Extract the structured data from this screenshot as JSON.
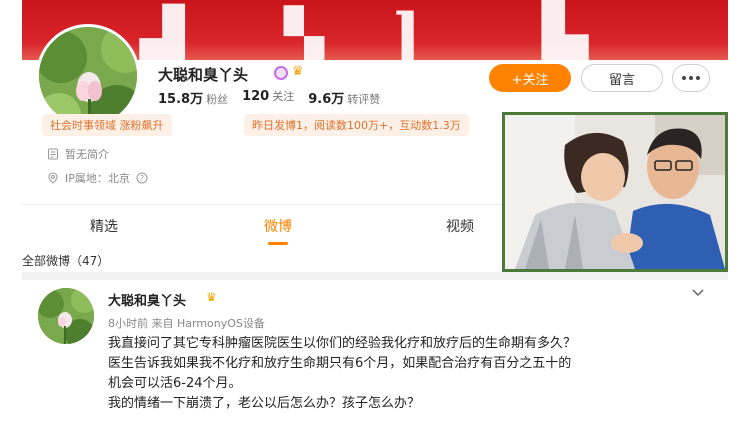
{
  "profile": {
    "name": "大聪和臭丫头",
    "followers_count": "15.8万",
    "followers_label": "粉丝",
    "following_count": "120",
    "following_label": "关注",
    "reposts_count": "9.6万",
    "reposts_label": "转评赞",
    "follow_button": "+关注",
    "message_button": "留言",
    "tag_domain": "社会时事领域 涨粉飙升",
    "tag_activity": "昨日发博1，阅读数100万+，互动数1.3万",
    "bio": "暂无简介",
    "ip_location": "IP属地：北京"
  },
  "tabs": [
    {
      "label": "精选"
    },
    {
      "label": "微博"
    },
    {
      "label": "视频"
    }
  ],
  "feed": {
    "all_label": "全部微博（47）",
    "post": {
      "author": "大聪和臭丫头",
      "meta": "8小时前  来自 HarmonyOS设备",
      "lines": [
        "我直接问了其它专科肿瘤医院医生以你们的经验我化疗和放疗后的生命期有多久？",
        "医生告诉我如果我不化疗和放疗生命期只有6个月，如果配合治疗有百分之五十的",
        "机会可以活6-24个月。",
        "我的情绪一下崩溃了，老公以后怎么办？孩子怎么办？"
      ]
    }
  },
  "colors": {
    "accent": "#ff8200",
    "banner": "#d8242a",
    "photo_border": "#4b7a3a"
  }
}
